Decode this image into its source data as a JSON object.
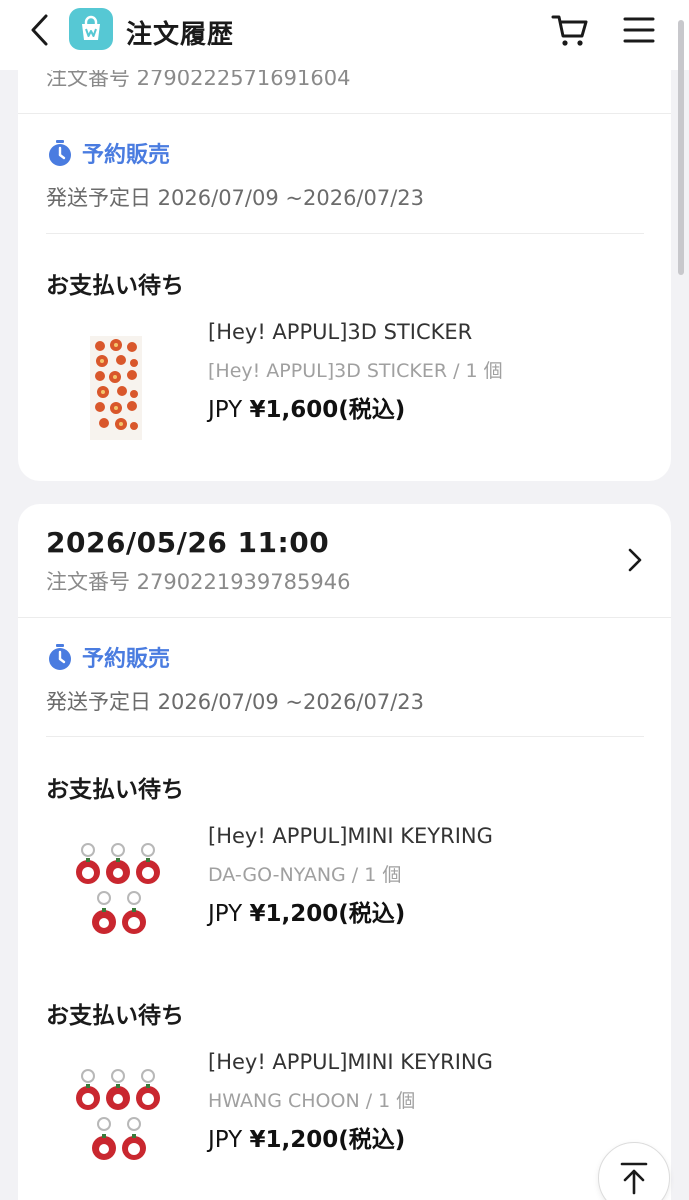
{
  "header": {
    "title": "注文履歴",
    "back_icon": "chevron-left-icon",
    "logo_icon": "shopping-bag-logo",
    "cart_icon": "cart-icon",
    "menu_icon": "hamburger-menu-icon"
  },
  "colors": {
    "accent": "#4a7ce0",
    "logo": "#56c8d4",
    "background": "#f2f2f5"
  },
  "orders": [
    {
      "order_no": "注文番号 2790222571691604",
      "preorder_label": "予約販売",
      "ship_date": "発送予定日 2026/07/09 ~2026/07/23",
      "items": [
        {
          "status": "お支払い待ち",
          "name": "[Hey! APPUL]3D STICKER",
          "option": "[Hey! APPUL]3D STICKER / 1 個",
          "price_prefix": "JPY",
          "price_amount": "¥1,600(税込)",
          "thumbnail": "sticker-sheet-image"
        }
      ]
    },
    {
      "date": "2026/05/26 11:00",
      "order_no": "注文番号 2790221939785946",
      "preorder_label": "予約販売",
      "ship_date": "発送予定日 2026/07/09 ~2026/07/23",
      "items": [
        {
          "status": "お支払い待ち",
          "name": "[Hey! APPUL]MINI KEYRING",
          "option": "DA-GO-NYANG / 1 個",
          "price_prefix": "JPY",
          "price_amount": "¥1,200(税込)",
          "thumbnail": "keyring-set-image"
        },
        {
          "status": "お支払い待ち",
          "name": "[Hey! APPUL]MINI KEYRING",
          "option": "HWANG CHOON / 1 個",
          "price_prefix": "JPY",
          "price_amount": "¥1,200(税込)",
          "thumbnail": "keyring-set-image"
        }
      ]
    }
  ],
  "scroll_top_icon": "arrow-up-icon"
}
